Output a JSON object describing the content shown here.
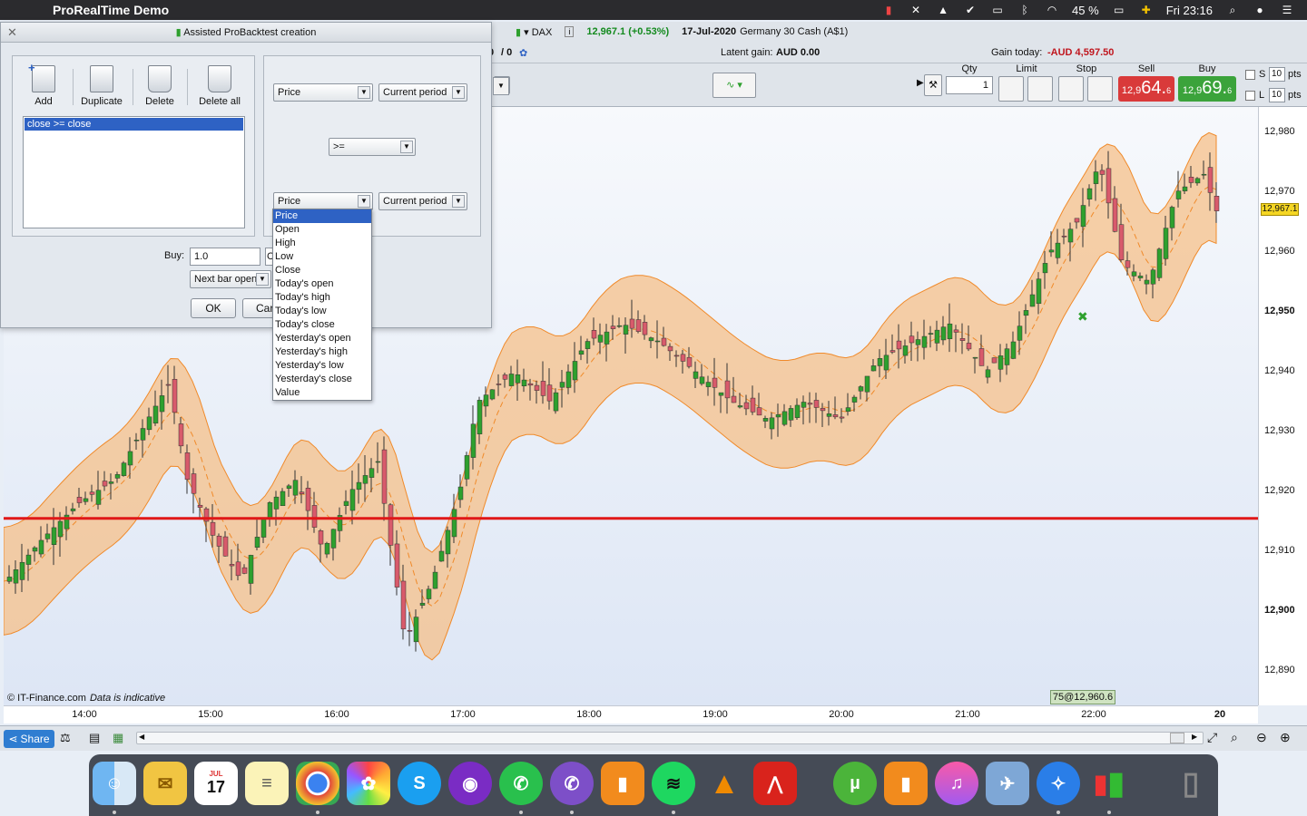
{
  "menubar": {
    "app_name": "ProRealTime Demo",
    "battery": "45 %",
    "clock": "Fri 23:16"
  },
  "dialog": {
    "title": "Assisted ProBacktest creation",
    "tools": {
      "add": "Add",
      "duplicate": "Duplicate",
      "delete": "Delete",
      "delete_all": "Delete all"
    },
    "conditions": [
      "close >= close"
    ],
    "left_operand": {
      "value": "Price",
      "period": "Current period"
    },
    "operator": ">=",
    "right_operand": {
      "value": "Price",
      "period": "Current period"
    },
    "buy_label": "Buy:",
    "buy_value": "1.0",
    "order_type": "Next bar open",
    "ok_label": "OK",
    "cancel_label": "Car"
  },
  "dropdown_options": [
    "Price",
    "Open",
    "High",
    "Low",
    "Close",
    "Today's open",
    "Today's high",
    "Today's low",
    "Today's close",
    "Yesterday's open",
    "Yesterday's high",
    "Yesterday's low",
    "Yesterday's close",
    "Value"
  ],
  "header": {
    "instrument": "DAX",
    "price_change": "12,967.1 (+0.53%)",
    "date": "17-Jul-2020",
    "market": "Germany 30 Cash (A$1)",
    "counter": "0",
    "counter2": "0",
    "latent_gain_label": "Latent gain:",
    "latent_gain_value": "AUD 0.00",
    "gain_today_label": "Gain today:",
    "gain_today_value": "-AUD 4,597.50"
  },
  "trade": {
    "qty_label": "Qty",
    "qty_value": "1",
    "limit_label": "Limit",
    "stop_label": "Stop",
    "sell_label": "Sell",
    "buy_label": "Buy",
    "sell_small": "12,9",
    "sell_big": "64.",
    "sell_sup": "6",
    "buy_small": "12,9",
    "buy_big": "69.",
    "buy_sup": "6",
    "s_label": "S",
    "l_label": "L",
    "pts_value": "10",
    "pts_label": "pts"
  },
  "chart": {
    "last_price": "12,967.1",
    "copyright": "© IT-Finance.com",
    "disclaimer": "Data is indicative",
    "signal_label": "75@12,960.6",
    "colors": {
      "up": "#2ea02e",
      "down": "#d85a6b",
      "band": "#f5c08a",
      "band_line": "#f08a2a",
      "hline": "#e01818"
    }
  },
  "chart_data": {
    "type": "candlestick",
    "y_ticks": [
      "12,980",
      "12,970",
      "12,960",
      "12,950",
      "12,940",
      "12,930",
      "12,920",
      "12,910",
      "12,900",
      "12,890"
    ],
    "bold_ticks": [
      "12,950",
      "12,900"
    ],
    "x_ticks": [
      "14:00",
      "15:00",
      "16:00",
      "17:00",
      "18:00",
      "19:00",
      "20:00",
      "21:00",
      "22:00",
      "20"
    ],
    "ylim": [
      12885,
      12985
    ],
    "horizontal_line": 12915.5
  },
  "bottom": {
    "share_label": "Share"
  },
  "dock": {
    "calendar_month": "JUL",
    "calendar_day": "17"
  }
}
